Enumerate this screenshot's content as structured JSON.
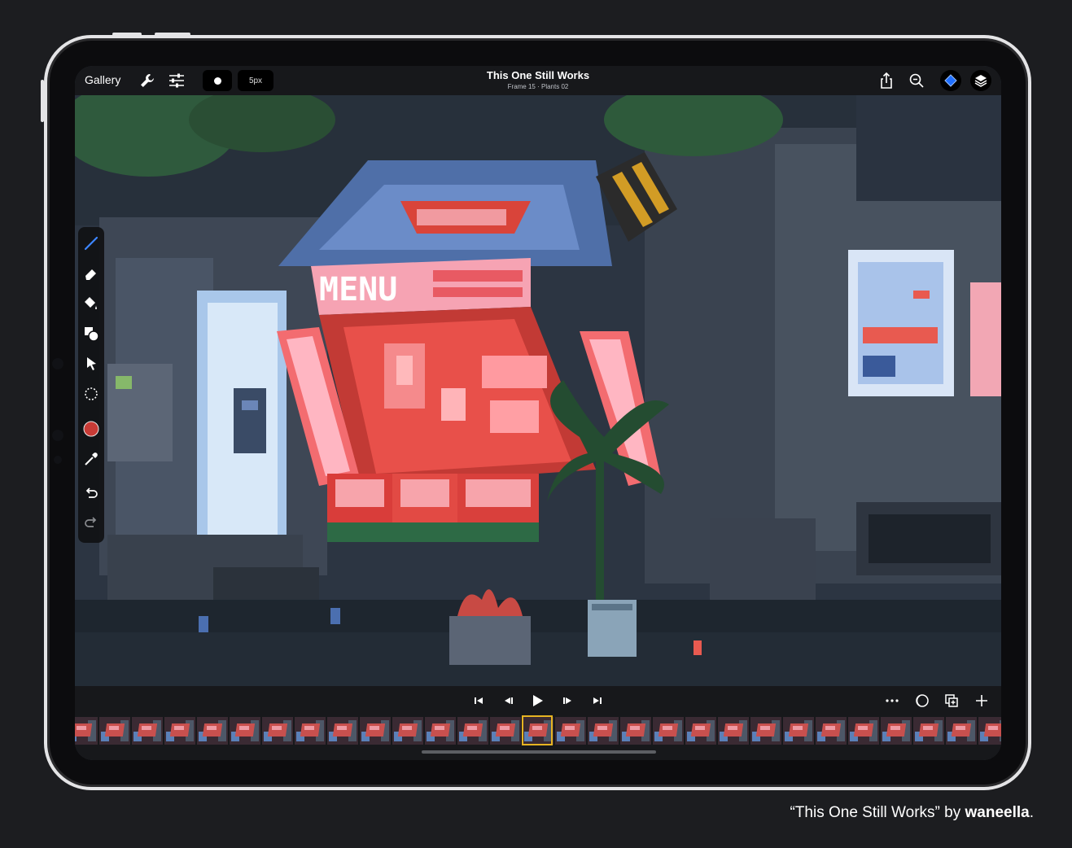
{
  "topbar": {
    "gallery_label": "Gallery",
    "brush_size": "5px",
    "title": "This One Still Works",
    "subtitle": "Frame 15 · Plants 02",
    "icons": [
      "wrench-icon",
      "sliders-icon",
      "brush-dot-icon",
      "share-icon",
      "zoom-icon",
      "selection-diamond-icon",
      "layers-icon"
    ]
  },
  "left_tools": {
    "icons": [
      "pencil-icon",
      "eraser-icon",
      "fill-bucket-icon",
      "shapes-icon",
      "move-arrow-icon",
      "lasso-icon",
      "color-swatch-icon",
      "eyedropper-icon",
      "undo-icon",
      "redo-icon"
    ],
    "current_color": "#c83b36"
  },
  "playbar": {
    "icons": [
      "skip-to-start-icon",
      "step-back-icon",
      "play-icon",
      "step-forward-icon",
      "skip-to-end-icon",
      "more-icon",
      "onion-skin-icon",
      "duplicate-frame-icon",
      "add-frame-icon"
    ]
  },
  "timeline": {
    "frame_count": 29,
    "selected_frame": 15
  },
  "caption": {
    "prefix": "“This One Still Works” by ",
    "author": "waneella",
    "suffix": "."
  },
  "colors": {
    "accent": "#1f6fff",
    "selection": "#e6b422",
    "neon_red": "#e8463c",
    "neon_pink": "#f7a8b8"
  }
}
